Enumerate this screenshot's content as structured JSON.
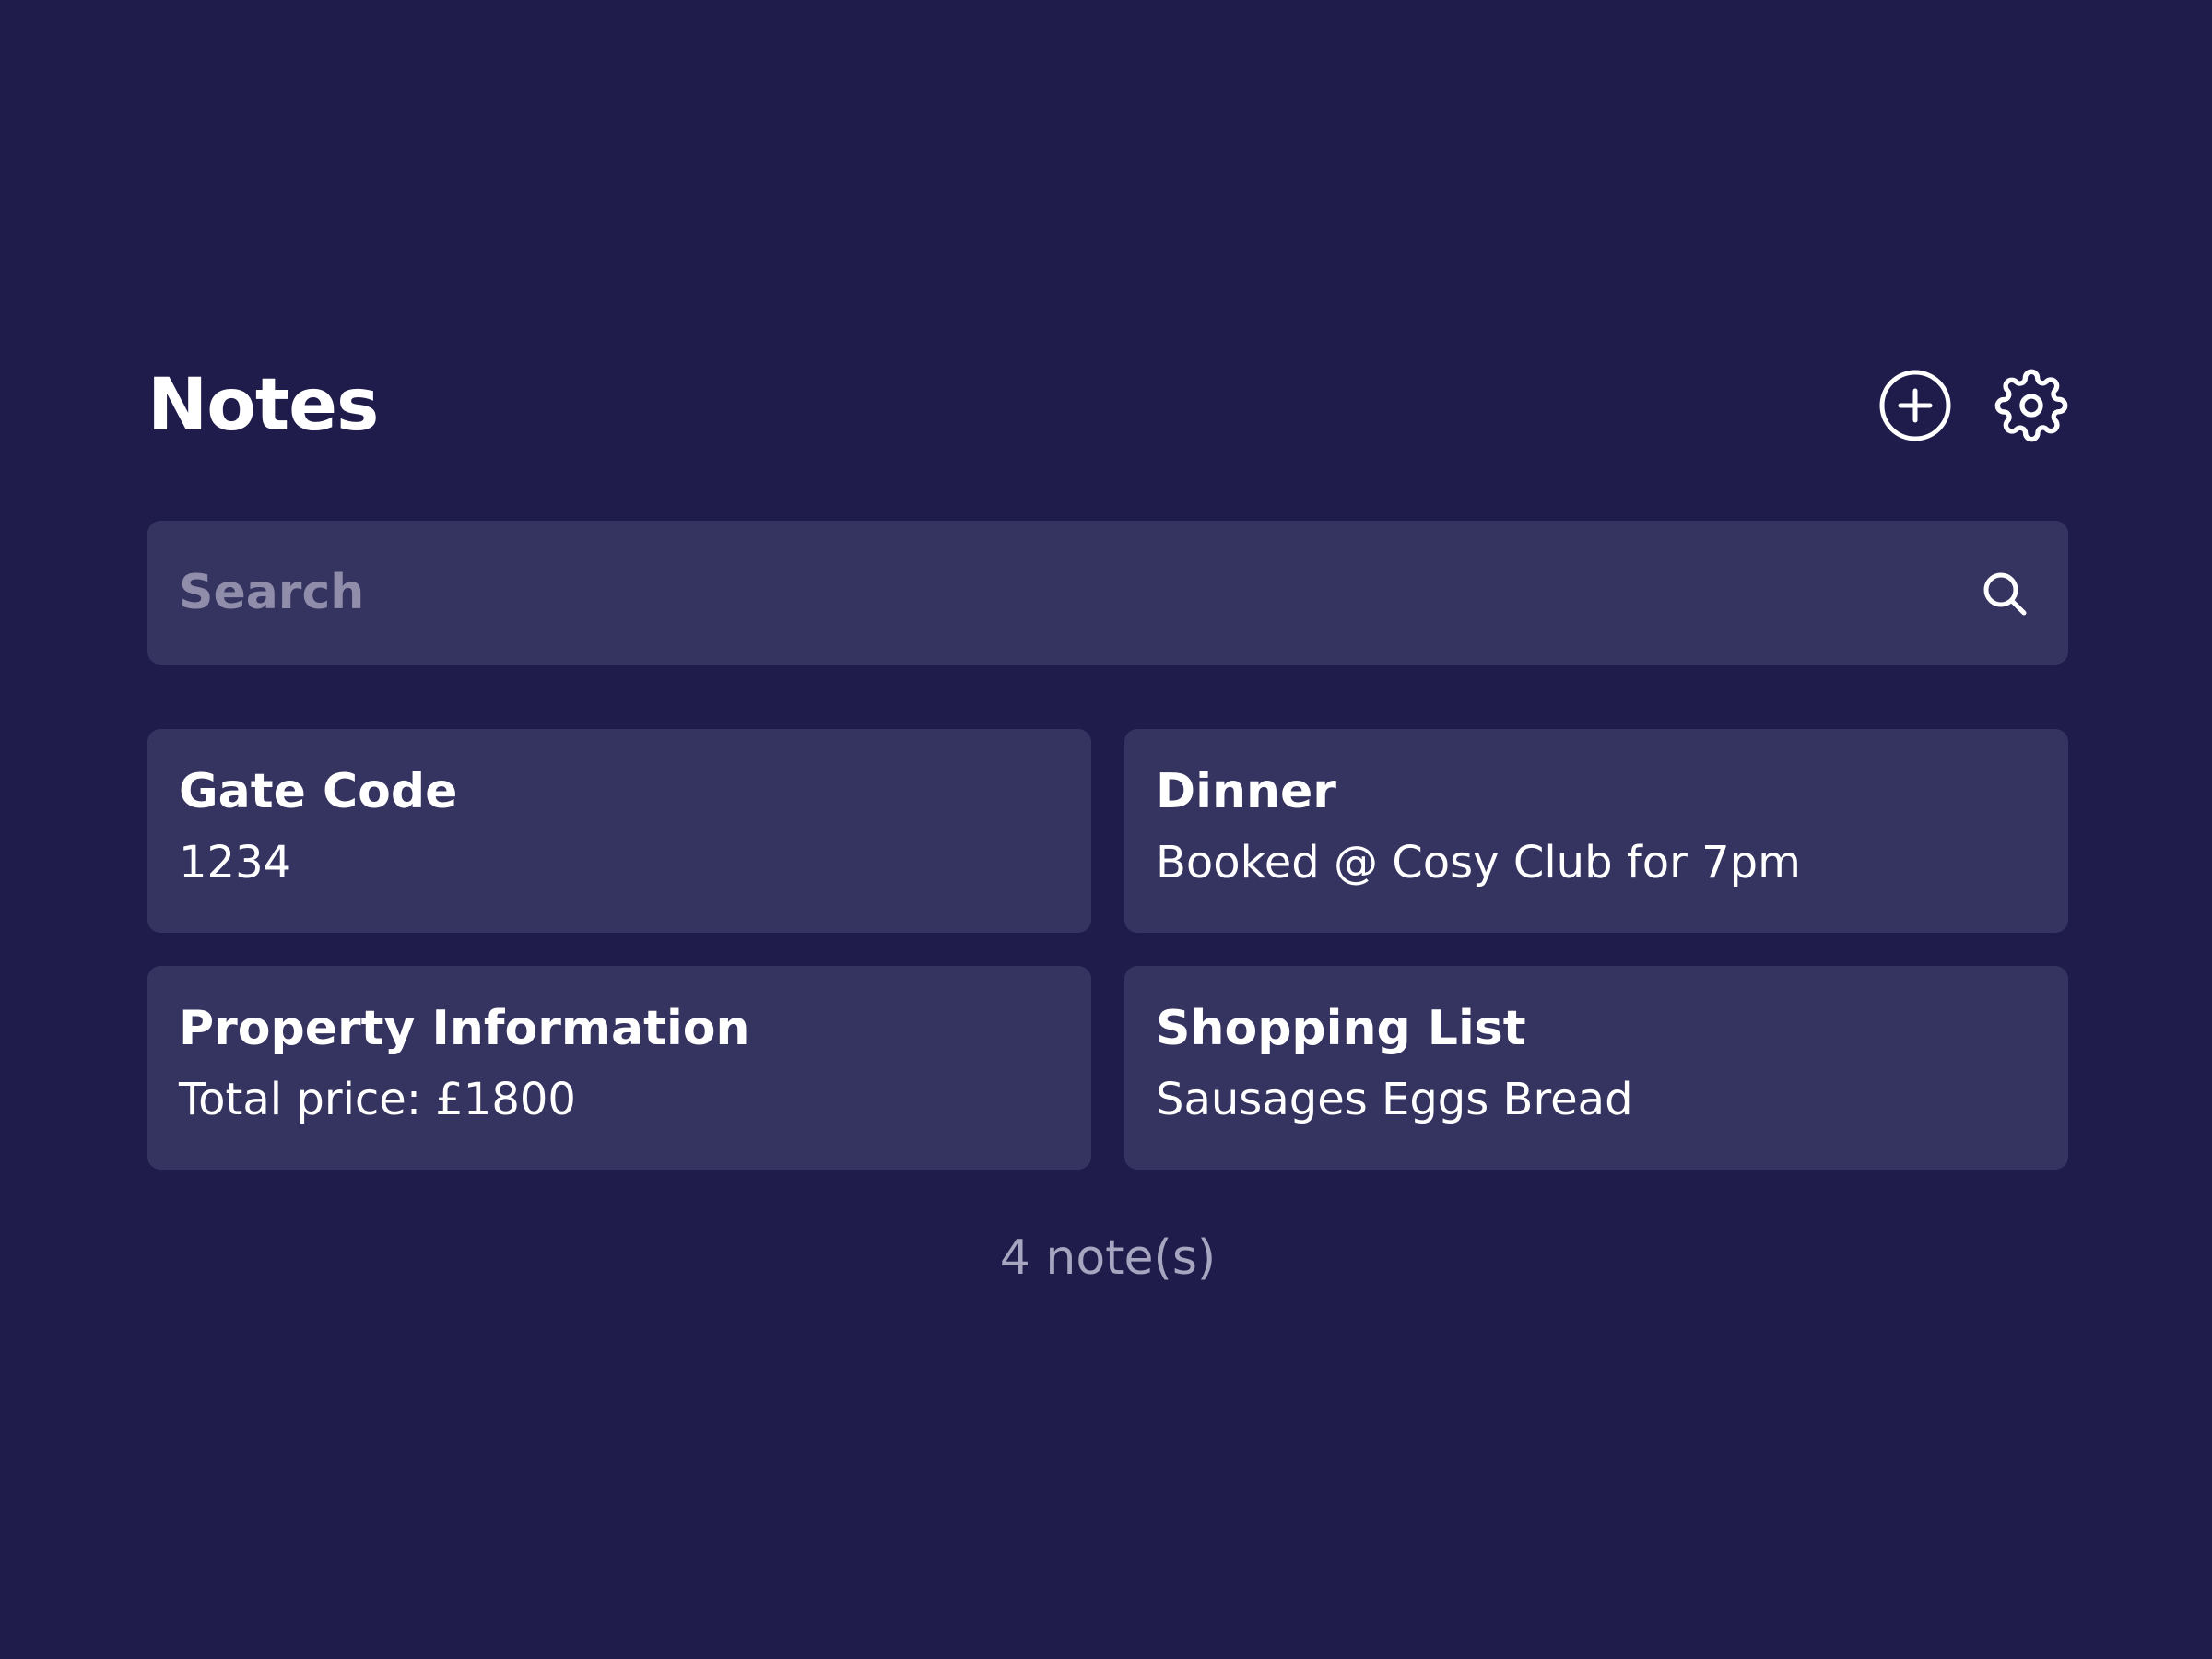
{
  "header": {
    "title": "Notes",
    "add_icon": "plus-circle-icon",
    "settings_icon": "gear-icon"
  },
  "search": {
    "placeholder": "Search",
    "value": "",
    "icon": "search-icon"
  },
  "notes": [
    {
      "title": "Gate Code",
      "body": "1234"
    },
    {
      "title": "Dinner",
      "body": "Booked @ Cosy Club for 7pm"
    },
    {
      "title": "Property Information",
      "body": "Total price: £1800"
    },
    {
      "title": "Shopping List",
      "body": "Sausages Eggs Bread"
    }
  ],
  "footer": {
    "count_label": "4 note(s)"
  },
  "colors": {
    "background": "#1f1b4b",
    "card": "#35335f",
    "text": "#ffffff",
    "muted": "#a7a5bf"
  }
}
